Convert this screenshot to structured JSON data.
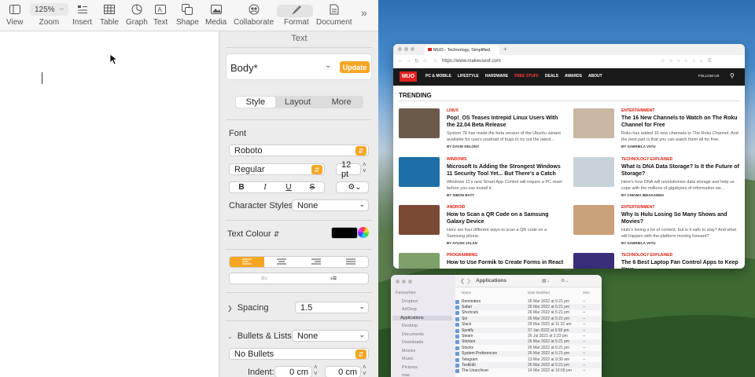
{
  "toolbar": {
    "view": "View",
    "zoom_value": "125%",
    "zoom": "Zoom",
    "insert": "Insert",
    "table": "Table",
    "chart": "Graph",
    "text": "Text",
    "shape": "Shape",
    "media": "Media",
    "collaborate": "Collaborate",
    "format": "Format",
    "document": "Document"
  },
  "panel": {
    "title": "Text",
    "style_name": "Body*",
    "update": "Update",
    "tabs": [
      "Style",
      "Layout",
      "More"
    ],
    "font_heading": "Font",
    "font_family": "Roboto",
    "font_style": "Regular",
    "font_size": "12 pt",
    "bold": "B",
    "italic": "I",
    "underline": "U",
    "strike": "S",
    "character_styles_label": "Character Styles",
    "character_styles_value": "None",
    "text_colour_label": "Text Colour",
    "spacing_label": "Spacing",
    "spacing_value": "1.5",
    "bullets_label": "Bullets & Lists",
    "bullets_value": "None",
    "bullets_select": "No Bullets",
    "indent_label": "Indent:",
    "indent_first": "0 cm",
    "indent_second": "0 cm",
    "colours": {
      "accent": "#f5a623",
      "text_colour": "#000000"
    }
  },
  "browser": {
    "tab_title": "MUO - Technology, Simplified.",
    "url": "https://www.makeuseof.com",
    "logo": "MUO",
    "nav": [
      "PC & MOBILE",
      "LIFESTYLE",
      "HARDWARE",
      "FREE STUFF",
      "DEALS",
      "AWARDS",
      "ABOUT"
    ],
    "follow": "FOLLOW US",
    "trending": "TRENDING",
    "articles": [
      {
        "category": "LINUX",
        "title": "Pop!_OS Teases Intrepid Linux Users With the 22.04 Beta Release",
        "excerpt": "System 76 has made the beta version of the Ubuntu variant available for users unafraid of bugs to try out the latest...",
        "author": "BY DAVID DELONY"
      },
      {
        "category": "ENTERTAINMENT",
        "title": "The 16 New Channels to Watch on The Roku Channel for Free",
        "excerpt": "Roku has added 16 new channels to The Roku Channel. And the best part is that you can watch them all for free.",
        "author": "BY GABRIELA VATU"
      },
      {
        "category": "WINDOWS",
        "title": "Microsoft Is Adding the Strongest Windows 11 Security Tool Yet... But There's a Catch",
        "excerpt": "Windows 11's new Smart App Control will require a PC reset before you can install it.",
        "author": "BY SIMON BATT"
      },
      {
        "category": "TECHNOLOGY EXPLAINED",
        "title": "What Is DNA Data Storage? Is It the Future of Storage?",
        "excerpt": "Here's how DNA will revolutionize data storage and help us cope with the millions of gigabytes of information we...",
        "author": "BY CHIOMA IBEAKANMA"
      },
      {
        "category": "ANDROID",
        "title": "How to Scan a QR Code on a Samsung Galaxy Device",
        "excerpt": "Here are four different ways to scan a QR code on a Samsung phone.",
        "author": "BY AYUSH JALAN"
      },
      {
        "category": "ENTERTAINMENT",
        "title": "Why Is Hulu Losing So Many Shows and Movies?",
        "excerpt": "Hulu's losing a lot of content, but is it safe to stay? And what will happen with the platform moving forward?",
        "author": "BY GABRIELA VATU"
      },
      {
        "category": "PROGRAMMING",
        "title": "How to Use Formik to Create Forms in React",
        "excerpt": "",
        "author": ""
      },
      {
        "category": "TECHNOLOGY EXPLAINED",
        "title": "The 6 Best Laptop Fan Control Apps to Keep Your",
        "excerpt": "",
        "author": ""
      }
    ],
    "thumb_colors": [
      "#6b5a4a",
      "#c9b7a2",
      "#1e6fa8",
      "#c8d2d8",
      "#7a4a35",
      "#caa07a",
      "#7ea06a",
      "#3a2d7a"
    ]
  },
  "finder": {
    "title": "Applications",
    "col_name": "Name",
    "col_date": "Date Modified",
    "col_size": "Size",
    "sidebar": [
      "Favourites",
      "Dropbox",
      "AirDrop",
      "Applications",
      "Desktop",
      "Documents",
      "Downloads",
      "Movies",
      "Music",
      "Pictures",
      "mac"
    ],
    "rows": [
      {
        "name": "Reminders",
        "date": "26 Mar 2022 at 5:21 pm"
      },
      {
        "name": "Safari",
        "date": "26 Mar 2022 at 5:21 pm"
      },
      {
        "name": "Shortcuts",
        "date": "26 Mar 2022 at 5:21 pm"
      },
      {
        "name": "Siri",
        "date": "26 Mar 2022 at 5:21 pm"
      },
      {
        "name": "Slack",
        "date": "29 Mar 2022 at 11:22 am"
      },
      {
        "name": "Spotify",
        "date": "27 Jan 2022 at 6:58 pm"
      },
      {
        "name": "Steam",
        "date": "26 Jul 2021 at 2:23 pm"
      },
      {
        "name": "Stickies",
        "date": "26 Mar 2022 at 5:21 pm"
      },
      {
        "name": "Stocks",
        "date": "26 Mar 2022 at 5:21 pm"
      },
      {
        "name": "System Preferences",
        "date": "26 Mar 2022 at 5:21 pm"
      },
      {
        "name": "Telegram",
        "date": "13 Mar 2022 at 9:30 am"
      },
      {
        "name": "TextEdit",
        "date": "26 Mar 2022 at 5:21 pm"
      },
      {
        "name": "The Unarchiver",
        "date": "14 Mar 2022 at 10:09 pm"
      }
    ]
  }
}
